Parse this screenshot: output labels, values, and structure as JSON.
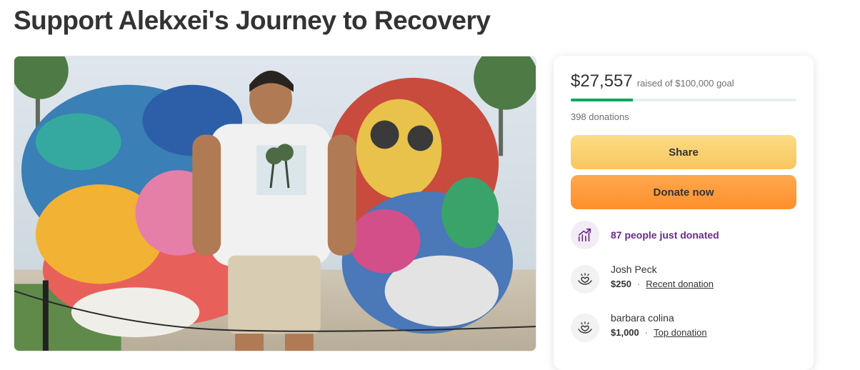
{
  "page": {
    "title": "Support Alekxei's Journey to Recovery"
  },
  "fundraiser": {
    "amount_raised": "$27,557",
    "goal_text": "raised of $100,000 goal",
    "progress_fraction": 0.2756,
    "donations_count": "398 donations",
    "share_label": "Share",
    "donate_label": "Donate now",
    "activity_text": "87 people just donated",
    "donors": [
      {
        "name": "Josh Peck",
        "amount": "$250",
        "tag": "Recent donation"
      },
      {
        "name": "barbara colina",
        "amount": "$1,000",
        "tag": "Top donation"
      }
    ]
  },
  "colors": {
    "progress": "#02a95c",
    "share_button": "#f8c65e",
    "donate_button": "#ff8f2c",
    "activity_text": "#6b2a8c"
  },
  "icons": {
    "activity": "trending-up-icon",
    "donor": "heart-hand-icon"
  }
}
